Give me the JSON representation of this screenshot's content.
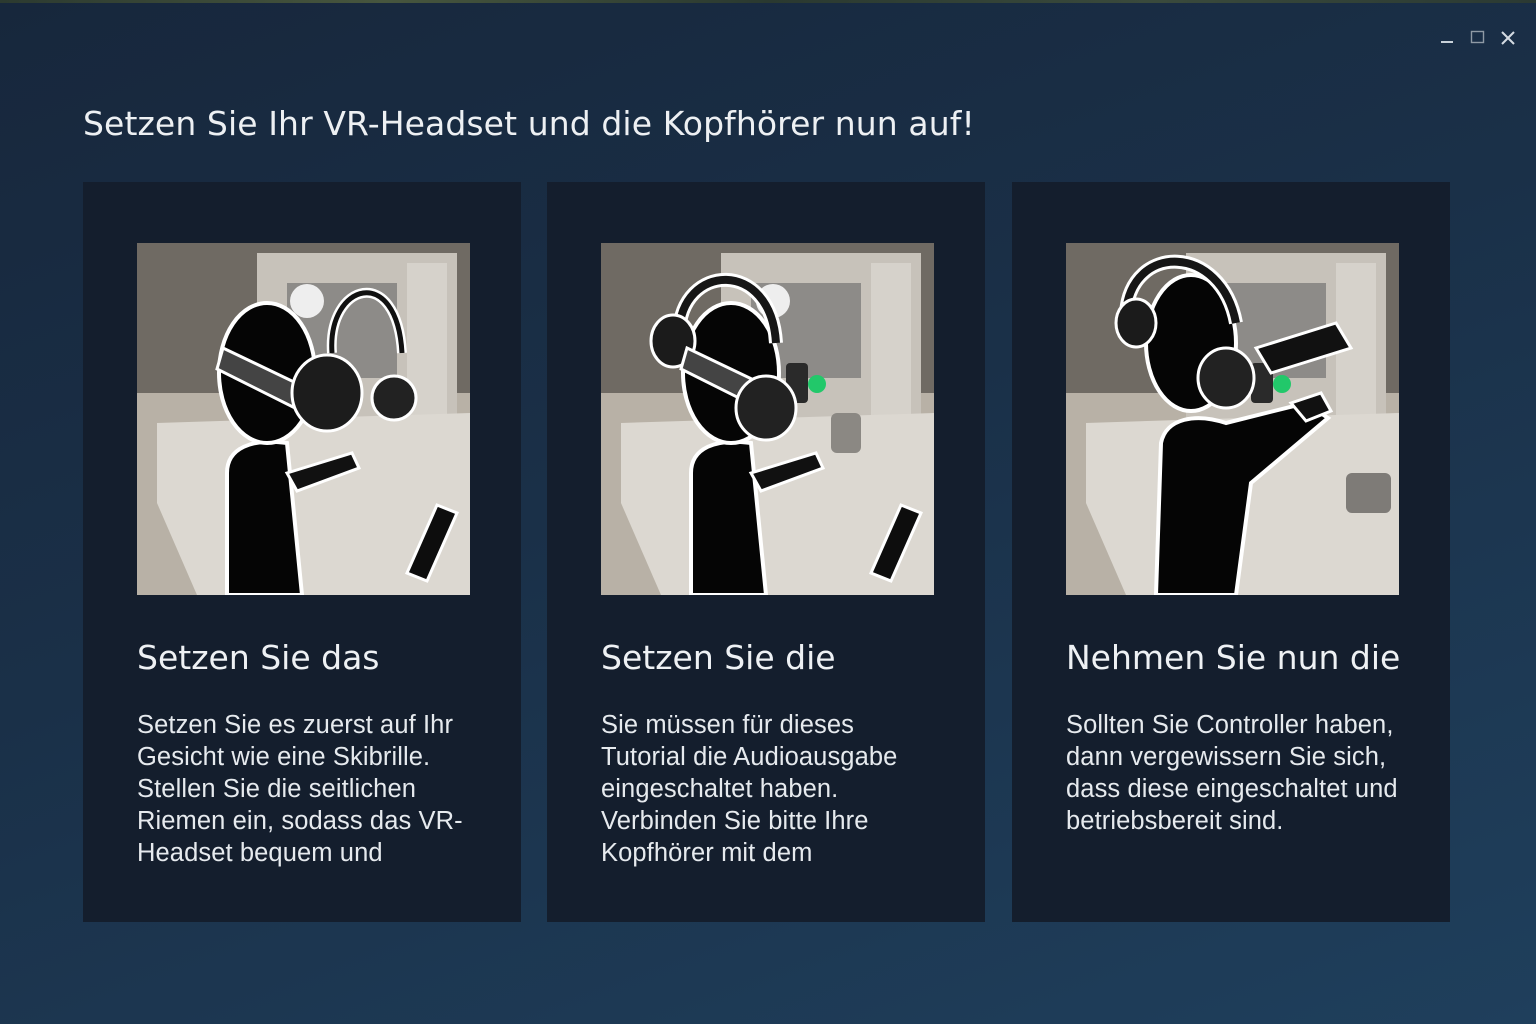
{
  "window": {
    "controls": [
      "minimize",
      "maximize",
      "close"
    ]
  },
  "page": {
    "title": "Setzen Sie Ihr VR-Headset und die Kopfhörer nun auf!"
  },
  "cards": [
    {
      "title": "Setzen Sie das",
      "body": "Setzen Sie es zuerst auf Ihr Gesicht wie eine Skibrille. Stellen Sie die seitlichen Riemen ein, sodass das VR-Headset bequem und",
      "image": "illustration-put-on-vr-headset"
    },
    {
      "title": "Setzen Sie die",
      "body": "Sie müssen für dieses Tutorial die Audioausgabe eingeschaltet haben. Verbinden Sie bitte Ihre Kopfhörer mit dem",
      "image": "illustration-put-on-headphones"
    },
    {
      "title": "Nehmen Sie nun die",
      "body": "Sollten Sie Controller haben, dann vergewissern Sie sich, dass diese eingeschaltet und betriebsbereit sind.",
      "image": "illustration-pick-up-controllers"
    }
  ],
  "colors": {
    "background": "#1a3048",
    "card": "#141e2d",
    "text": "#eef1f4",
    "status_light": "#22c86a"
  }
}
